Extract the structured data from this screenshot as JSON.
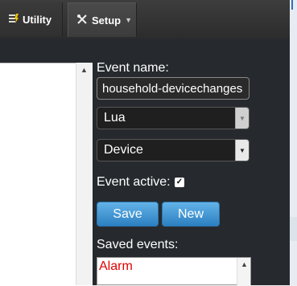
{
  "toolbar": {
    "utility_label": "Utility",
    "setup_label": "Setup"
  },
  "form": {
    "event_name_label": "Event name:",
    "event_name_value": "household-devicechanges",
    "language_value": "Lua",
    "event_type_value": "Device",
    "event_active_label": "Event active:",
    "event_active_checked": true,
    "save_label": "Save",
    "new_label": "New",
    "saved_events_label": "Saved events:",
    "saved_events": [
      "Alarm"
    ]
  },
  "icons": {
    "utility": "utility-icon",
    "setup": "tools-icon",
    "dropdown": "chevron-down-icon",
    "scroll_up": "scroll-up-arrow-icon"
  },
  "colors": {
    "toolbar": "#333333",
    "panel": "#262a2e",
    "button_blue": "#3a8fd0",
    "saved_event_text": "#e00000"
  }
}
